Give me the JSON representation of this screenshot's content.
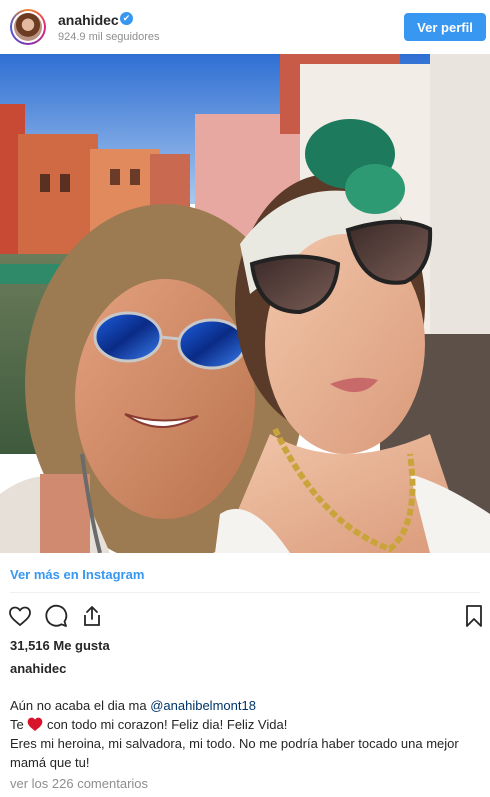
{
  "header": {
    "username": "anahidec",
    "verified_mark": "✔",
    "followers": "924.9 mil seguidores",
    "follow_button": "Ver perfil",
    "accent_color": "#3897f0"
  },
  "post": {
    "view_more": "Ver más en Instagram",
    "likes": "31,516 Me gusta",
    "author": "anahidec",
    "caption_line1_text": "Aún no acaba el dia ma ",
    "caption_mention": "@anahibelmont18",
    "caption_line2_prefix": "Te ",
    "caption_line2_suffix": " con todo mi corazon! Feliz dia! Feliz Vida!",
    "caption_line3": "Eres mi heroina, mi salvadora, mi todo. No me podría haber tocado una mejor mamá que tu!",
    "comments_link": "ver los 226 comentarios"
  },
  "icons": {
    "like": "heart-outline-icon",
    "comment": "speech-bubble-icon",
    "share": "share-upload-icon",
    "save": "bookmark-icon",
    "inline_emoji": "red-heart-icon"
  }
}
